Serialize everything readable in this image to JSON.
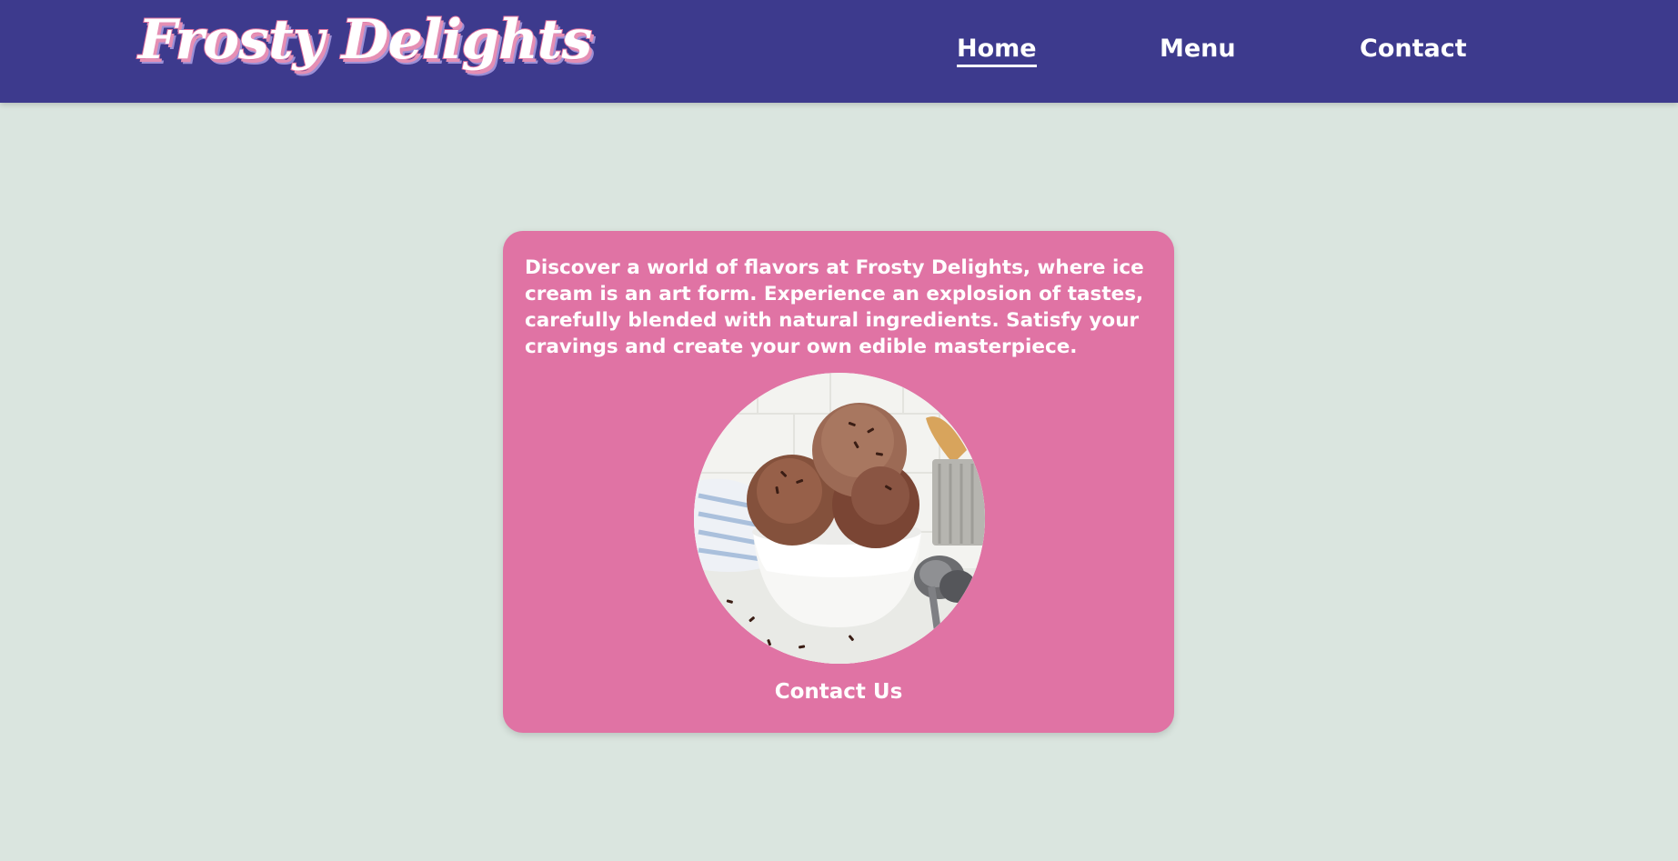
{
  "brand": {
    "logo_text": "Frosty Delights"
  },
  "nav": {
    "home": "Home",
    "menu": "Menu",
    "contact": "Contact",
    "active": "home"
  },
  "hero": {
    "description": "Discover a world of flavors at Frosty Delights, where ice cream is an art form. Experience an explosion of tastes, carefully blended with natural ingredients. Satisfy your cravings and create your own edible masterpiece.",
    "image_subject": "chocolate-ice-cream-bowl",
    "cta_label": "Contact Us"
  },
  "colors": {
    "header_bg": "#3d3a8d",
    "page_bg": "#dae5df",
    "card_bg": "#e073a4",
    "text": "#ffffff"
  }
}
